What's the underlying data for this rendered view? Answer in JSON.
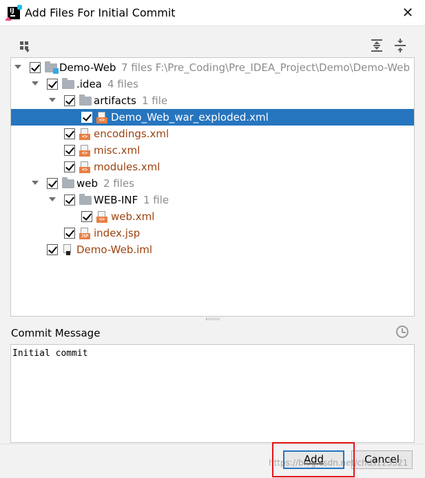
{
  "window": {
    "title": "Add Files For Initial Commit",
    "close_symbol": "✕"
  },
  "toolbar": {
    "group_by_icon": "group-by-icon",
    "expand_all_icon": "expand-all-icon",
    "collapse_all_icon": "collapse-all-icon"
  },
  "tree": [
    {
      "name": "Demo-Web",
      "meta": "7 files  F:\\Pre_Coding\\Pre_IDEA_Project\\Demo\\Demo-Web",
      "kind": "module-folder",
      "expanded": true,
      "checked": true,
      "depth": 0
    },
    {
      "name": ".idea",
      "meta": "4 files",
      "kind": "folder",
      "expanded": true,
      "checked": true,
      "depth": 1
    },
    {
      "name": "artifacts",
      "meta": "1 file",
      "kind": "folder",
      "expanded": true,
      "checked": true,
      "depth": 2
    },
    {
      "name": "Demo_Web_war_exploded.xml",
      "meta": "",
      "kind": "xml",
      "checked": true,
      "depth": 3,
      "selected": true
    },
    {
      "name": "encodings.xml",
      "meta": "",
      "kind": "xml",
      "checked": true,
      "depth": 2
    },
    {
      "name": "misc.xml",
      "meta": "",
      "kind": "xml",
      "checked": true,
      "depth": 2
    },
    {
      "name": "modules.xml",
      "meta": "",
      "kind": "xml",
      "checked": true,
      "depth": 2
    },
    {
      "name": "web",
      "meta": "2 files",
      "kind": "folder",
      "expanded": true,
      "checked": true,
      "depth": 1
    },
    {
      "name": "WEB-INF",
      "meta": "1 file",
      "kind": "folder",
      "expanded": true,
      "checked": true,
      "depth": 2
    },
    {
      "name": "web.xml",
      "meta": "",
      "kind": "xml",
      "checked": true,
      "depth": 3
    },
    {
      "name": "index.jsp",
      "meta": "",
      "kind": "jsp",
      "checked": true,
      "depth": 2
    },
    {
      "name": "Demo-Web.iml",
      "meta": "",
      "kind": "iml",
      "checked": true,
      "depth": 1
    }
  ],
  "commit": {
    "label": "Commit Message",
    "message": "Initial commit",
    "history_icon": "clock-icon"
  },
  "buttons": {
    "add_label": "Add",
    "cancel_label": "Cancel"
  },
  "watermark": "https://blog.csdn.net/chds123321",
  "colors": {
    "selection": "#2675bf",
    "new_file_text": "#9c4310",
    "meta_text": "#8c8c8c",
    "highlight_box": "#e0151b",
    "xml_tag": "#e87e43"
  }
}
